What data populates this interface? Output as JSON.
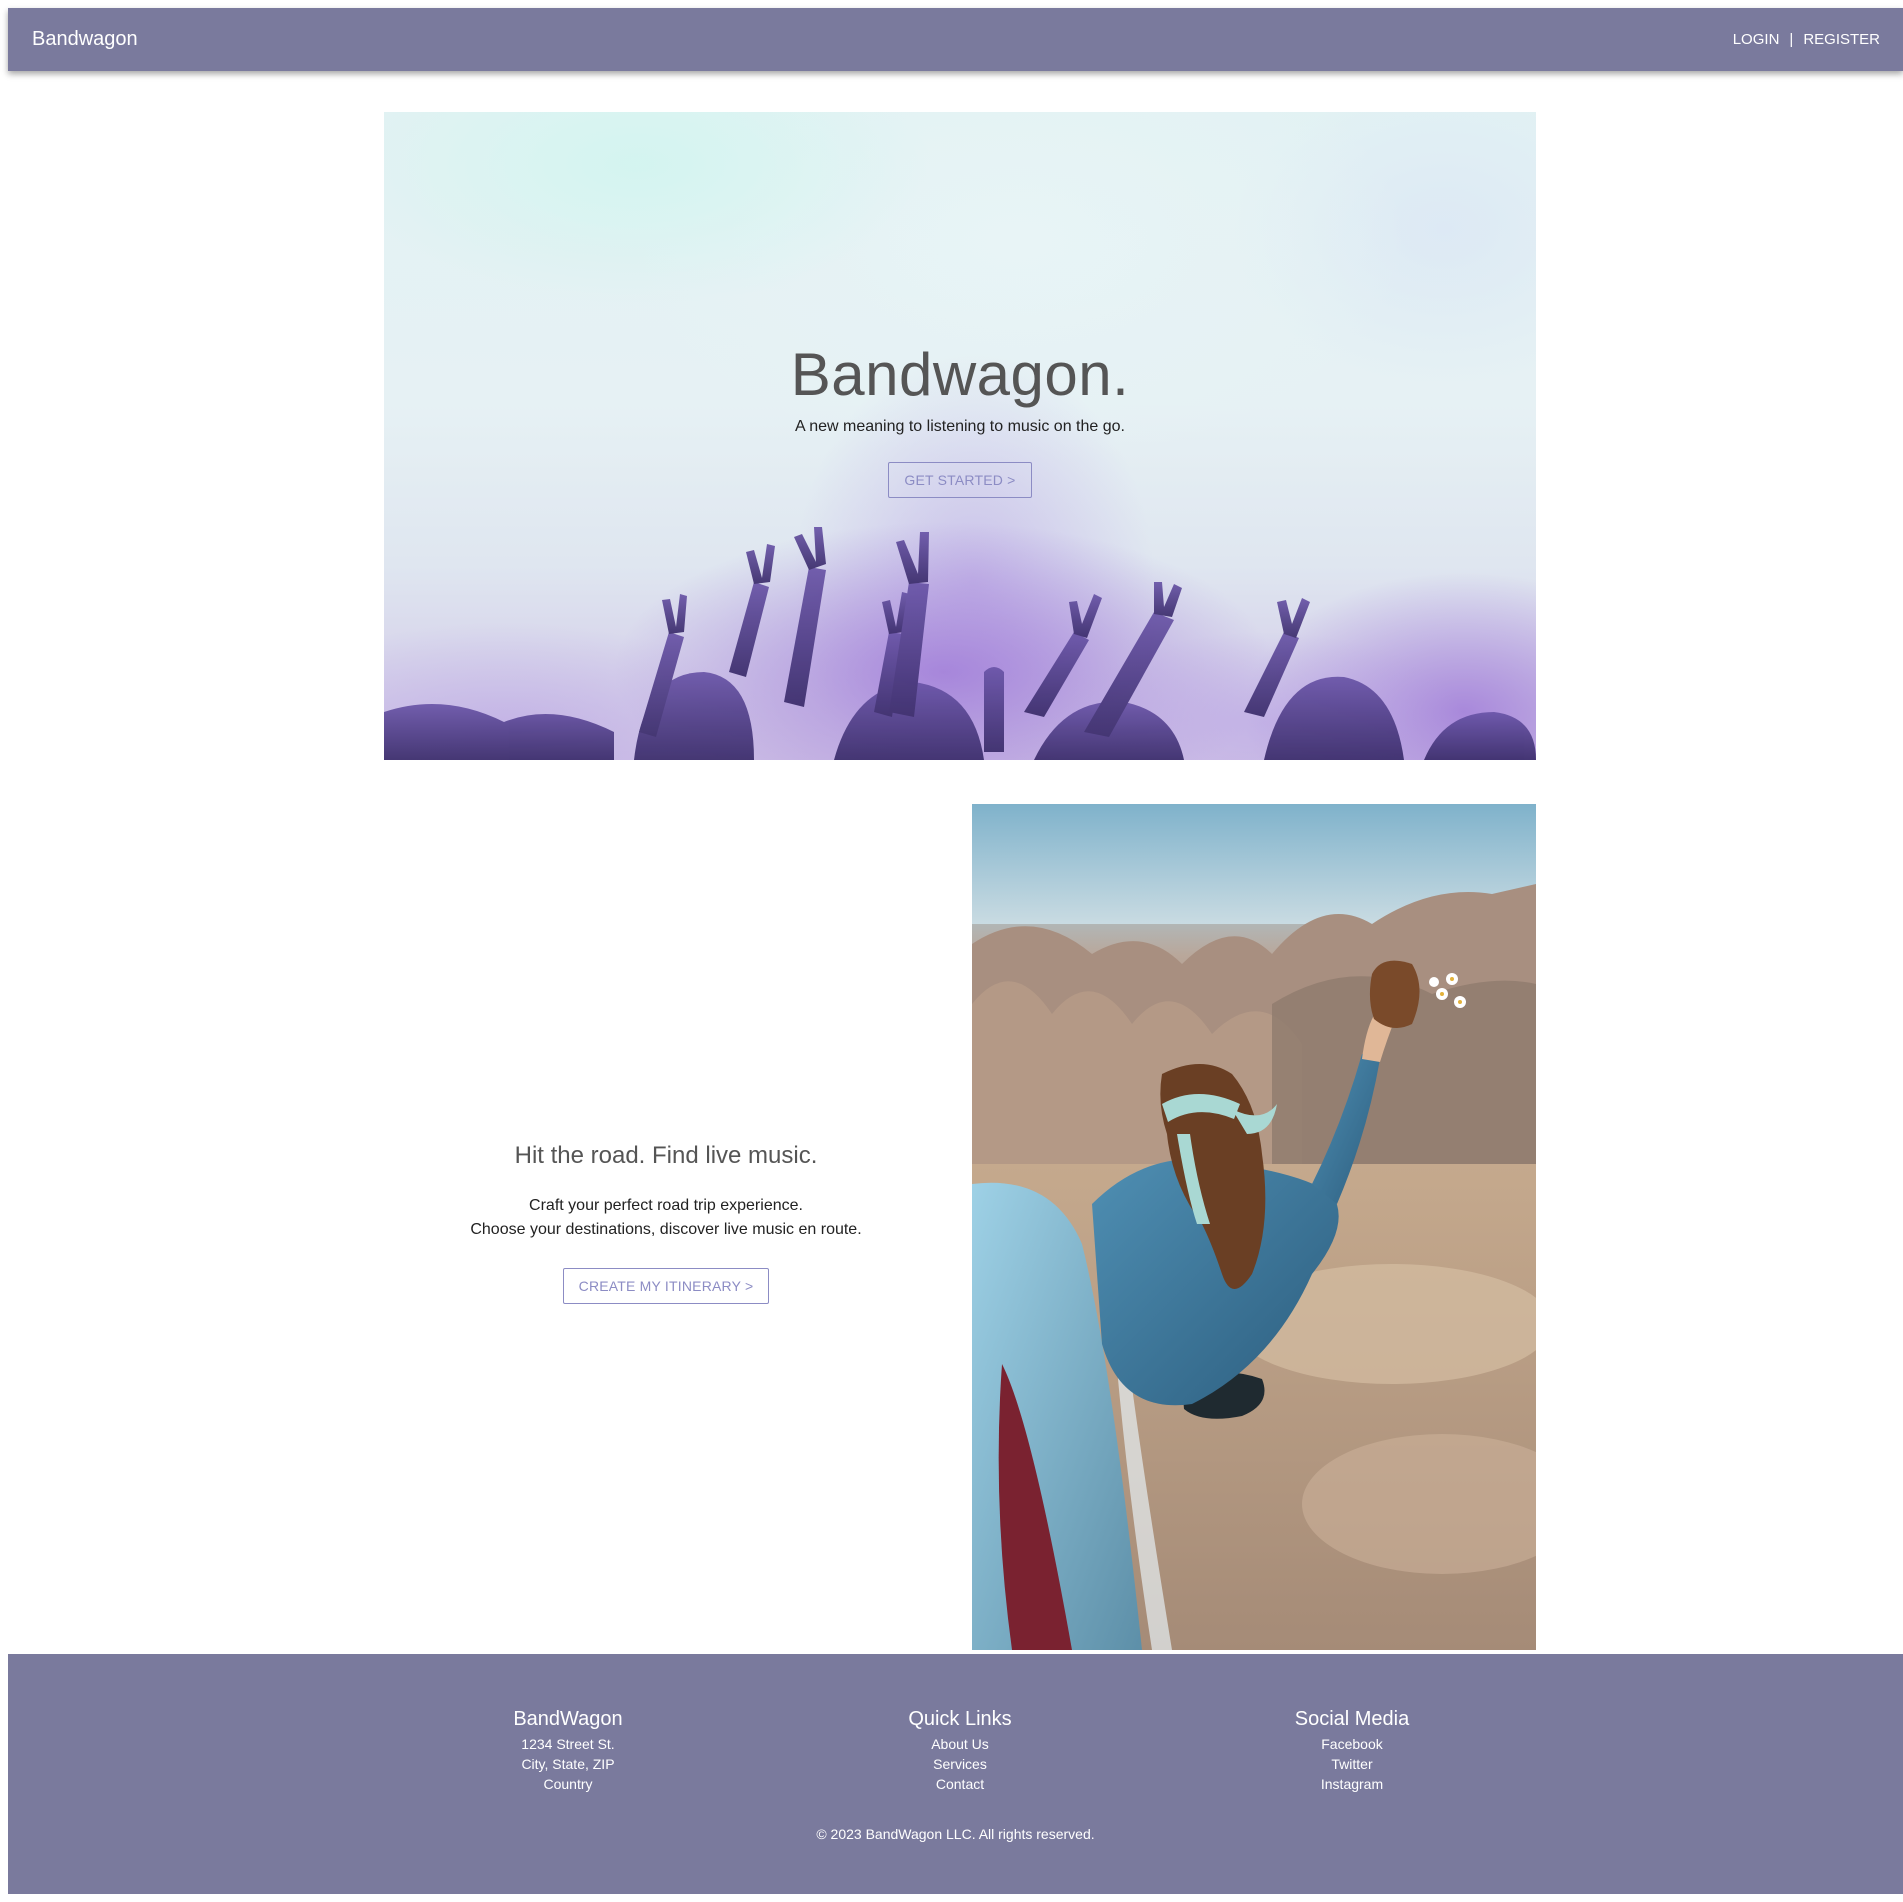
{
  "nav": {
    "brand": "Bandwagon",
    "login": "LOGIN",
    "separator": "|",
    "register": "REGISTER"
  },
  "hero": {
    "title": "Bandwagon.",
    "subtitle": "A new meaning to listening to music on the go.",
    "cta": "GET STARTED >"
  },
  "feature": {
    "title": "Hit the road. Find live music.",
    "line1": "Craft your perfect road trip experience.",
    "line2": "Choose your destinations, discover live music en route.",
    "cta": "CREATE MY ITINERARY >"
  },
  "footer": {
    "company": {
      "heading": "BandWagon",
      "address1": "1234 Street St.",
      "address2": "City, State, ZIP",
      "address3": "Country"
    },
    "quick_links": {
      "heading": "Quick Links",
      "items": [
        "About Us",
        "Services",
        "Contact"
      ]
    },
    "social": {
      "heading": "Social Media",
      "items": [
        "Facebook",
        "Twitter",
        "Instagram"
      ]
    },
    "copyright": "© 2023 BandWagon LLC. All rights reserved."
  },
  "colors": {
    "nav_bg": "#7a7a9d",
    "accent": "#8c8cc4",
    "heading_gray": "#555555"
  }
}
